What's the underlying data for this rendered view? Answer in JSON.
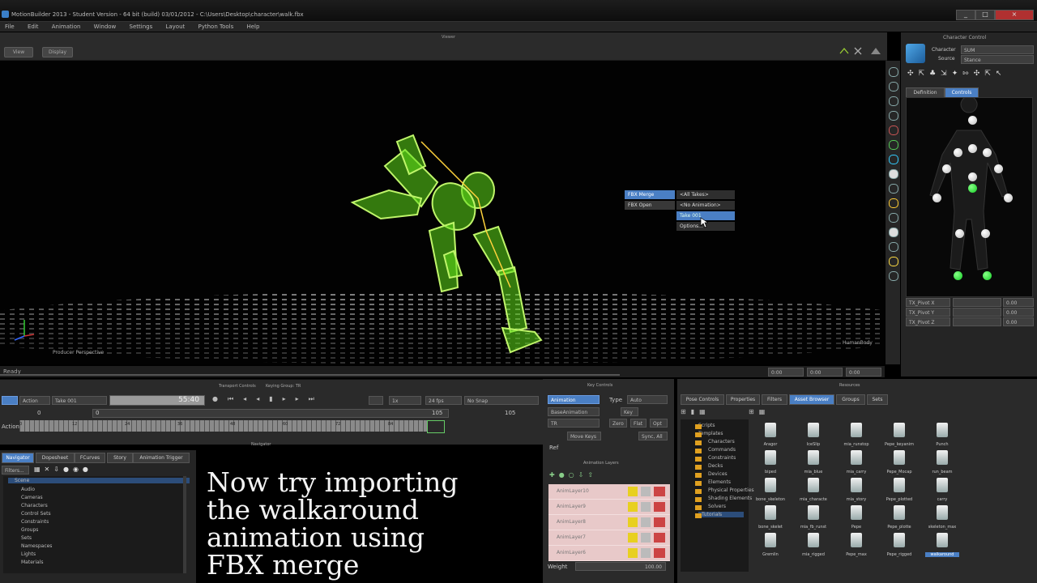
{
  "window": {
    "title": "MotionBuilder 2013 - Student Version - 64 bit (build) 03/01/2012 - C:\\Users\\Desktop\\character\\walk.fbx",
    "controls": [
      "_",
      "□",
      "×"
    ]
  },
  "menu": [
    "File",
    "Edit",
    "Animation",
    "Window",
    "Settings",
    "Layout",
    "Python Tools",
    "Help"
  ],
  "toolbar": {
    "view_label": "Viewer",
    "btn1": "View",
    "btn2": "Display"
  },
  "viewport": {
    "camera_label": "Producer Perspective",
    "right_label": "HumanBody",
    "status": "Ready",
    "timecodes": [
      "0:00",
      "0:00",
      "0:00"
    ]
  },
  "popup": {
    "left_items": [
      "FBX Merge",
      "FBX Open"
    ],
    "submenu": [
      "<All Takes>",
      "<No Animation>",
      "Take 001",
      "Options..."
    ]
  },
  "character_control": {
    "title": "Character Control",
    "character_label": "Character",
    "character_value": "SUM",
    "source_label": "Source",
    "source_value": "Stance",
    "tabs": [
      "Definition",
      "Controls"
    ],
    "rows": [
      "TX_Pivot X",
      "TX_Pivot Y",
      "TX_Pivot Z"
    ],
    "row_values": [
      "0.00",
      "0.00",
      "0.00"
    ]
  },
  "transport": {
    "title": "Transport Controls",
    "keying_group": "Keying Group: TR",
    "mode": "Action",
    "take": "Take 001",
    "timecode": "55:40",
    "speed": "1x",
    "fps": "24 fps",
    "snap": "No Snap",
    "start": "0",
    "end": "105",
    "end2": "105",
    "track_label": "Action",
    "ticks": [
      "0",
      "12",
      "24",
      "36",
      "48",
      "60",
      "72",
      "84",
      "96"
    ]
  },
  "key_controls": {
    "title": "Key Controls",
    "animation_btn": "Animation",
    "type_label": "Type",
    "type_value": "Auto",
    "layer_value": "BaseAnimation",
    "key_label": "Key",
    "filter_value": "TR",
    "zero": "Zero",
    "flat": "Flat",
    "opt": "Opt",
    "move_keys": "Move Keys",
    "ref_label": "Ref",
    "sync": "Sync, All",
    "layers_title": "Animation Layers",
    "layers": [
      "AnimLayer10",
      "AnimLayer9",
      "AnimLayer8",
      "AnimLayer7",
      "AnimLayer6"
    ],
    "weight_label": "Weight",
    "weight_value": "100.00"
  },
  "navigator": {
    "title": "Navigator",
    "tabs": [
      "Navigator",
      "Dopesheet",
      "FCurves",
      "Story",
      "Animation Trigger"
    ],
    "filter": "Filters...",
    "tree": [
      "Scene",
      "Audio",
      "Cameras",
      "Characters",
      "Control Sets",
      "Constraints",
      "Groups",
      "Sets",
      "Namespaces",
      "Lights",
      "Materials"
    ]
  },
  "caption": [
    "Now try importing",
    "the walkaround",
    "animation using",
    "FBX merge"
  ],
  "resources": {
    "title": "Resources",
    "tabs": [
      "Pose Controls",
      "Properties",
      "Filters",
      "Asset Browser",
      "Groups",
      "Sets"
    ],
    "folders": [
      "Scripts",
      "Templates",
      "Characters",
      "Commands",
      "Constraints",
      "Decks",
      "Devices",
      "Elements",
      "Physical Properties",
      "Shading Elements",
      "Solvers",
      "Tutorials"
    ],
    "assets": [
      "Aragor",
      "IceSlip",
      "mia_runstop",
      "Pepe_keyanim",
      "Punch",
      "biped",
      "mia_blue",
      "mia_carry",
      "Pepe_Mocap",
      "run_beam",
      "bone_skeleton",
      "mia_characte",
      "mia_story",
      "Pepe_plotted",
      "carry",
      "bone_skelet",
      "mia_fb_runst",
      "Pepe",
      "Pepe_plotte",
      "skeleton_max",
      "Gremlin",
      "mia_rigged",
      "Pepe_max",
      "Pepe_rigged",
      "walkaround"
    ]
  }
}
